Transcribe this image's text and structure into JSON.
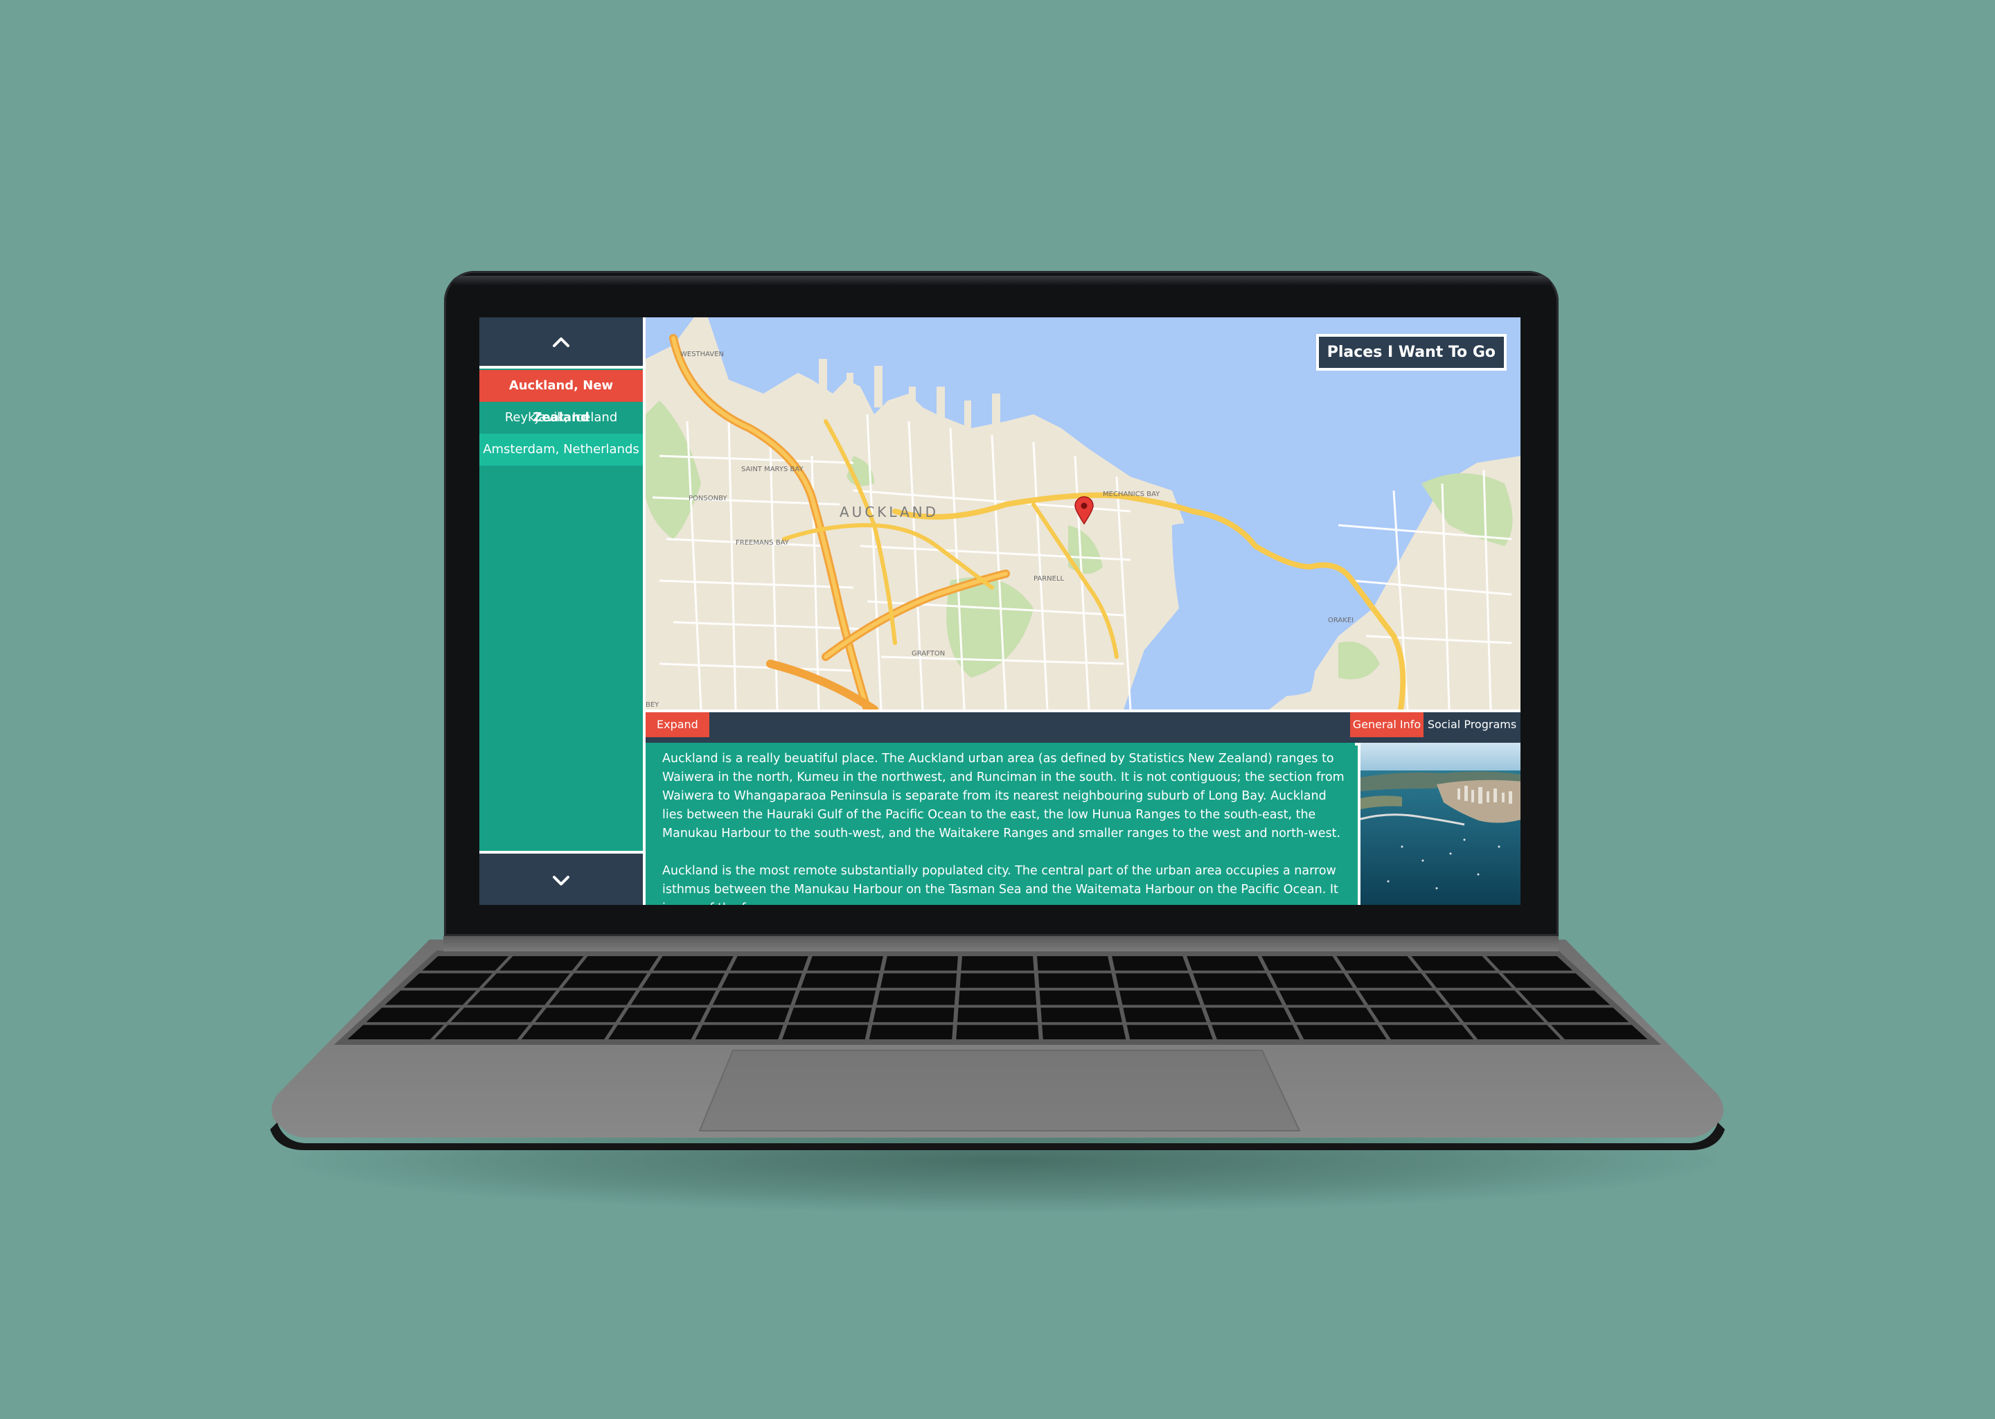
{
  "sidebar": {
    "places": [
      {
        "label": "Auckland, New Zealand",
        "active": true
      },
      {
        "label": "Reykjavik, Iceland",
        "active": false
      },
      {
        "label": "Amsterdam, Netherlands",
        "active": false
      }
    ]
  },
  "map": {
    "title": "Places I Want To Go",
    "city_label": "AUCKLAND",
    "labels": [
      "WESTHAVEN",
      "SAINT MARYS BAY",
      "PONSONBY",
      "FREEMANS BAY",
      "MECHANICS BAY",
      "PARNELL",
      "GRAFTON",
      "ORAKEI",
      "BEY"
    ]
  },
  "toolbar": {
    "expand_label": "Expand",
    "tabs": [
      {
        "label": "General Info",
        "active": true
      },
      {
        "label": "Social Programs",
        "active": false
      }
    ]
  },
  "article": {
    "paragraphs": [
      "Auckland is a really beuatiful place. The Auckland urban area (as defined by Statistics New Zealand) ranges to Waiwera in the north, Kumeu in the northwest, and Runciman in the south. It is not contiguous; the section from Waiwera to Whangaparaoa Peninsula is separate from its nearest neighbouring suburb of Long Bay. Auckland lies between the Hauraki Gulf of the Pacific Ocean to the east, the low Hunua Ranges to the south-east, the Manukau Harbour to the south-west, and the Waitakere Ranges and smaller ranges to the west and north-west.",
      "Auckland is the most remote substantially populated city. The central part of the urban area occupies a narrow isthmus between the Manukau Harbour on the Tasman Sea and the Waitemata Harbour on the Pacific Ocean. It is one of the few"
    ]
  },
  "colors": {
    "background": "#6fa197",
    "teal": "#17a086",
    "navy": "#2c3e50",
    "accent": "#e74c3c",
    "light_teal": "#1abc9c",
    "water": "#a9c9f7"
  },
  "icons": {
    "up": "chevron-up-icon",
    "down": "chevron-down-icon",
    "pin": "map-pin-icon"
  }
}
